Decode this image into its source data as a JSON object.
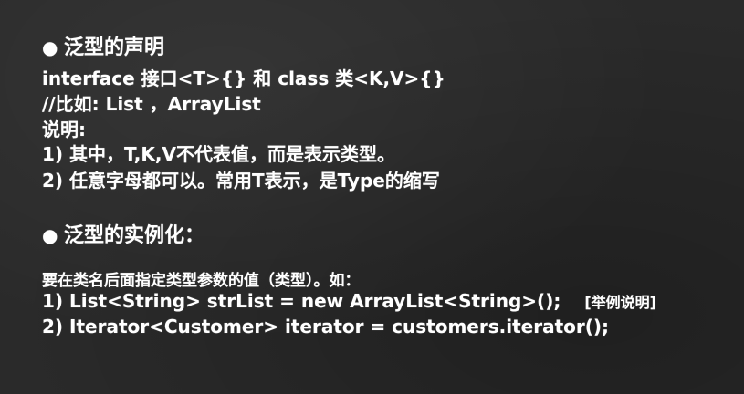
{
  "section1": {
    "bullet": "●",
    "title": "泛型的声明",
    "line1": "interface 接口<T>{} 和 class 类<K,V>{}",
    "line2": "//比如: List ，ArrayList",
    "line3": "说明:",
    "line4": "1) 其中，T,K,V不代表值，而是表示类型。",
    "line5": "2) 任意字母都可以。常用T表示，是Type的缩写"
  },
  "section2": {
    "bullet": "●",
    "title": "泛型的实例化：",
    "intro": "要在类名后面指定类型参数的值（类型）。如：",
    "example1": "1) List<String> strList = new ArrayList<String>();",
    "example1_tag": "[举例说明]",
    "example2": "2) Iterator<Customer> iterator = customers.iterator();"
  }
}
